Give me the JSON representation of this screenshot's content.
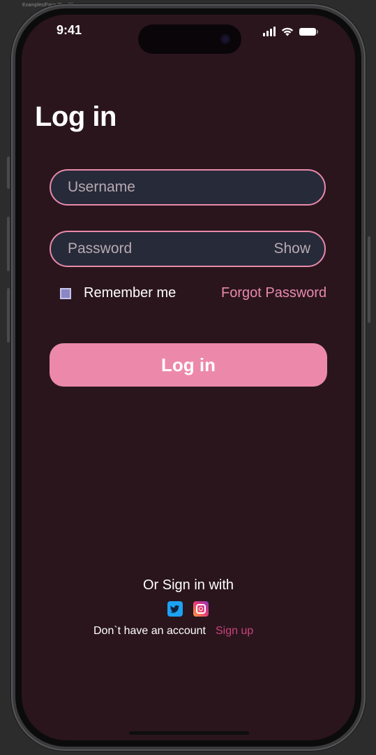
{
  "frame_label": "Examples/Face ID – iPhone",
  "status_bar": {
    "time": "9:41"
  },
  "login": {
    "title": "Log in",
    "username_placeholder": "Username",
    "password_placeholder": "Password",
    "show_label": "Show",
    "remember_label": "Remember me",
    "remember_checked": false,
    "forgot_label": "Forgot Password",
    "submit_label": "Log in"
  },
  "social": {
    "heading": "Or Sign in with",
    "providers": [
      "twitter-icon",
      "instagram-icon"
    ]
  },
  "signup": {
    "prompt": "Don`t have an account",
    "link_label": "Sign up"
  },
  "colors": {
    "background": "#2a151d",
    "accent": "#ec89aa",
    "field_bg": "#272a39",
    "signup_link": "#c9437a"
  }
}
